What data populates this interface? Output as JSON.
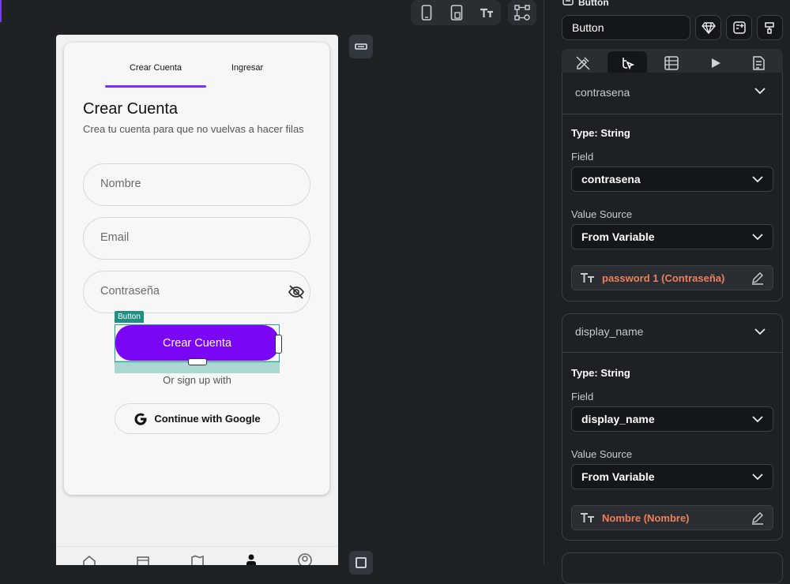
{
  "canvas": {
    "toolbar_icons": [
      "phone-icon",
      "tablet-icon",
      "text-size-icon",
      "node-graph-icon"
    ],
    "phone": {
      "tabs": [
        {
          "label": "Crear Cuenta",
          "active": true
        },
        {
          "label": "Ingresar",
          "active": false
        }
      ],
      "title": "Crear Cuenta",
      "subtitle": "Crea tu cuenta para que no vuelvas a hacer filas",
      "fields": [
        {
          "placeholder": "Nombre"
        },
        {
          "placeholder": "Email"
        },
        {
          "placeholder": "Contraseña",
          "icon": "eye-off-icon"
        }
      ],
      "selection_tag": "Button",
      "primary_button": "Crear Cuenta",
      "or_text": "Or sign up with",
      "google_button": "Continue with Google",
      "nav_icons": [
        "home-icon",
        "calendar-icon",
        "map-icon",
        "person-icon",
        "profile-circle-icon"
      ]
    }
  },
  "panel": {
    "header_label": "Button",
    "name_value": "Button",
    "header_actions": [
      "diamond-icon",
      "add-component-icon",
      "brush-icon"
    ],
    "tabs": [
      {
        "icon": "properties-icon",
        "active": false
      },
      {
        "icon": "actions-icon",
        "active": true
      },
      {
        "icon": "backend-query-icon",
        "active": false
      },
      {
        "icon": "animation-play-icon",
        "active": false
      },
      {
        "icon": "notes-icon",
        "active": false
      }
    ],
    "sections": [
      {
        "title": "contrasena",
        "type_label": "Type: String",
        "field_label": "Field",
        "field_value": "contrasena",
        "source_label": "Value Source",
        "source_value": "From Variable",
        "variable": "password 1 (Contraseña)"
      },
      {
        "title": "display_name",
        "type_label": "Type: String",
        "field_label": "Field",
        "field_value": "display_name",
        "source_label": "Value Source",
        "source_value": "From Variable",
        "variable": "Nombre (Nombre)"
      }
    ],
    "colors": {
      "accent": "#7a06f5",
      "variable_text": "#ef7f5a",
      "selection": "#2aa198"
    }
  }
}
